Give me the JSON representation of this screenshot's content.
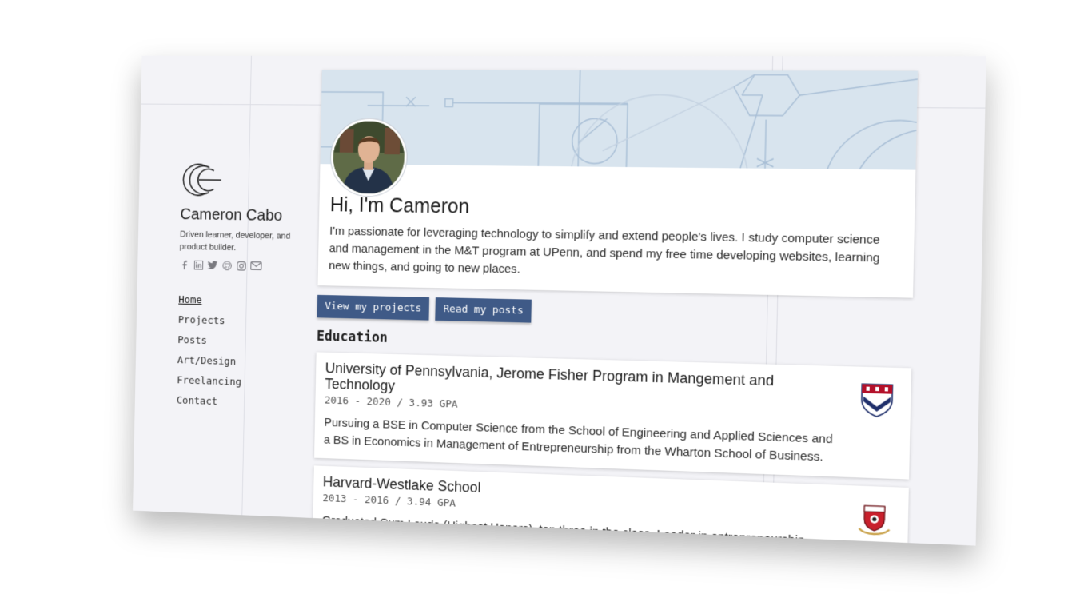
{
  "sidebar": {
    "name": "Cameron Cabo",
    "tagline": "Driven learner, developer, and product builder.",
    "social_icons": [
      "facebook-icon",
      "linkedin-icon",
      "twitter-icon",
      "github-icon",
      "instagram-icon",
      "mail-icon"
    ],
    "nav": [
      {
        "label": "Home",
        "active": true
      },
      {
        "label": "Projects",
        "active": false
      },
      {
        "label": "Posts",
        "active": false
      },
      {
        "label": "Art/Design",
        "active": false
      },
      {
        "label": "Freelancing",
        "active": false
      },
      {
        "label": "Contact",
        "active": false
      }
    ]
  },
  "hero": {
    "title": "Hi, I'm Cameron",
    "text": "I'm passionate for leveraging technology to simplify and extend people's lives. I study computer science and management in the M&T program at UPenn, and spend my free time developing websites, learning new things, and going to new places."
  },
  "buttons": {
    "projects": "View my projects",
    "posts": "Read my posts"
  },
  "education": {
    "title": "Education",
    "items": [
      {
        "name": "University of Pennsylvania, Jerome Fisher Program in Mangement and Technology",
        "years": "2016 - 2020 / 3.93 GPA",
        "description": "Pursuing a BSE in Computer Science from the School of Engineering and Applied Sciences and a BS in Economics in Management of Entrepreneurship from the Wharton School of Business.",
        "logo": "penn-shield-icon"
      },
      {
        "name": "Harvard-Westlake School",
        "years": "2013 - 2016 / 3.94 GPA",
        "description": "Graduated Cum Laude (Highest Honors), top three in the class. Leader in entrepreneurship, ethics, and current events clubs on campus.",
        "logo": "harvard-westlake-crest-icon"
      }
    ]
  },
  "colors": {
    "accent": "#3f5a87",
    "banner": "#d8e4ee",
    "page_bg": "#f3f3f7"
  }
}
